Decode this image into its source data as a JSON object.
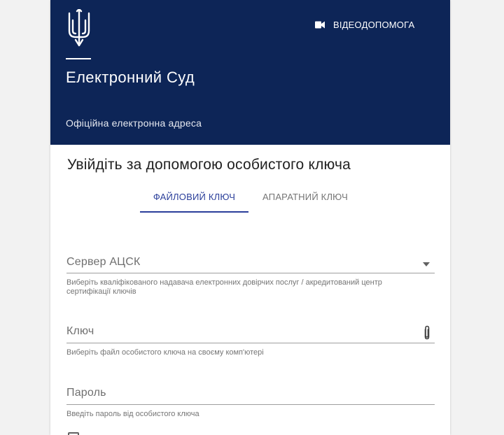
{
  "header": {
    "app_title": "Електронний Суд",
    "app_subtitle": "Офіційна електронна адреса",
    "video_help_label": "ВІДЕОДОПОМОГА"
  },
  "login": {
    "title": "Увійдіть за допомогою особистого ключа",
    "tabs": [
      {
        "label": "ФАЙЛОВИЙ КЛЮЧ",
        "active": true
      },
      {
        "label": "АПАРАТНИЙ КЛЮЧ",
        "active": false
      }
    ]
  },
  "form": {
    "server": {
      "label": "Сервер АЦСК",
      "hint": "Виберіть кваліфікованого надавача електронних довірчих послуг / акредитований центр сертифікації ключів"
    },
    "key": {
      "label": "Ключ",
      "hint": "Виберіть файл особистого ключа на своєму комп'ютері"
    },
    "password": {
      "label": "Пароль",
      "hint": "Введіть пароль від особистого ключа"
    }
  },
  "icons": {
    "emblem": "trident-icon",
    "video": "video-camera-icon",
    "dropdown": "arrow-drop-down-icon",
    "attach": "paperclip-icon"
  },
  "colors": {
    "header_bg": "#0d2557",
    "accent": "#2a3e9a",
    "text_primary": "#212121",
    "text_secondary": "#757575"
  }
}
